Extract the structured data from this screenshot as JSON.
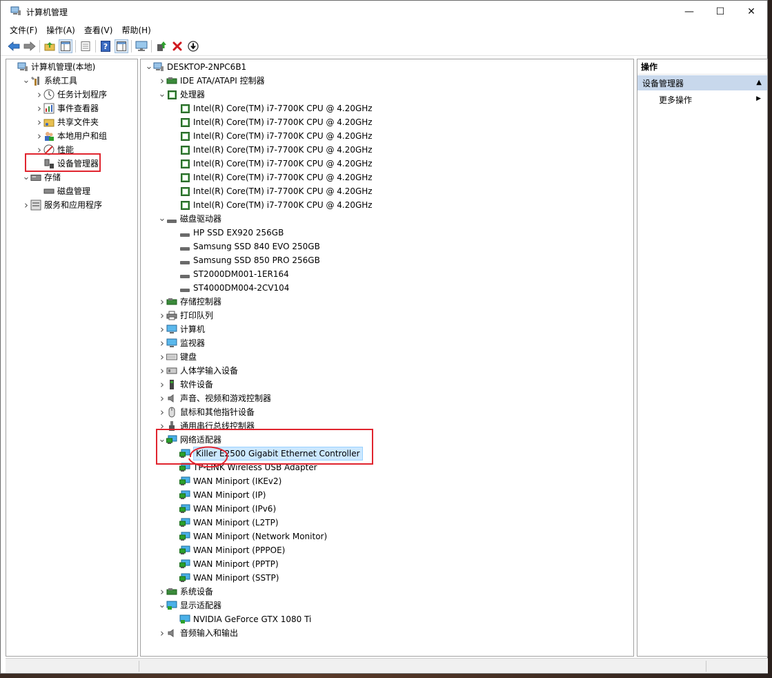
{
  "window": {
    "title": "计算机管理",
    "minimize": "—",
    "maximize": "☐",
    "close": "✕"
  },
  "menu": [
    "文件(F)",
    "操作(A)",
    "查看(V)",
    "帮助(H)"
  ],
  "left_tree": [
    {
      "label": "计算机管理(本地)",
      "level": 0,
      "expander": "",
      "icon": "computer-management-icon"
    },
    {
      "label": "系统工具",
      "level": 1,
      "expander": "open",
      "icon": "tools-icon"
    },
    {
      "label": "任务计划程序",
      "level": 2,
      "expander": "closed",
      "icon": "clock-icon"
    },
    {
      "label": "事件查看器",
      "level": 2,
      "expander": "closed",
      "icon": "event-viewer-icon"
    },
    {
      "label": "共享文件夹",
      "level": 2,
      "expander": "closed",
      "icon": "shared-folder-icon"
    },
    {
      "label": "本地用户和组",
      "level": 2,
      "expander": "closed",
      "icon": "users-icon"
    },
    {
      "label": "性能",
      "level": 2,
      "expander": "closed",
      "icon": "performance-icon"
    },
    {
      "label": "设备管理器",
      "level": 2,
      "expander": "",
      "icon": "device-manager-icon"
    },
    {
      "label": "存储",
      "level": 1,
      "expander": "open",
      "icon": "storage-icon"
    },
    {
      "label": "磁盘管理",
      "level": 2,
      "expander": "",
      "icon": "disk-management-icon"
    },
    {
      "label": "服务和应用程序",
      "level": 1,
      "expander": "closed",
      "icon": "services-icon"
    }
  ],
  "device_tree": [
    {
      "label": "DESKTOP-2NPC6B1",
      "level": 0,
      "expander": "open",
      "icon": "computer-icon"
    },
    {
      "label": "IDE ATA/ATAPI 控制器",
      "level": 1,
      "expander": "closed",
      "icon": "ide-controller-icon"
    },
    {
      "label": "处理器",
      "level": 1,
      "expander": "open",
      "icon": "processor-icon"
    },
    {
      "label": "Intel(R) Core(TM) i7-7700K CPU @ 4.20GHz",
      "level": 2,
      "expander": "",
      "icon": "processor-icon"
    },
    {
      "label": "Intel(R) Core(TM) i7-7700K CPU @ 4.20GHz",
      "level": 2,
      "expander": "",
      "icon": "processor-icon"
    },
    {
      "label": "Intel(R) Core(TM) i7-7700K CPU @ 4.20GHz",
      "level": 2,
      "expander": "",
      "icon": "processor-icon"
    },
    {
      "label": "Intel(R) Core(TM) i7-7700K CPU @ 4.20GHz",
      "level": 2,
      "expander": "",
      "icon": "processor-icon"
    },
    {
      "label": "Intel(R) Core(TM) i7-7700K CPU @ 4.20GHz",
      "level": 2,
      "expander": "",
      "icon": "processor-icon"
    },
    {
      "label": "Intel(R) Core(TM) i7-7700K CPU @ 4.20GHz",
      "level": 2,
      "expander": "",
      "icon": "processor-icon"
    },
    {
      "label": "Intel(R) Core(TM) i7-7700K CPU @ 4.20GHz",
      "level": 2,
      "expander": "",
      "icon": "processor-icon"
    },
    {
      "label": "Intel(R) Core(TM) i7-7700K CPU @ 4.20GHz",
      "level": 2,
      "expander": "",
      "icon": "processor-icon"
    },
    {
      "label": "磁盘驱动器",
      "level": 1,
      "expander": "open",
      "icon": "disk-icon"
    },
    {
      "label": "HP SSD EX920 256GB",
      "level": 2,
      "expander": "",
      "icon": "disk-icon"
    },
    {
      "label": "Samsung SSD 840 EVO 250GB",
      "level": 2,
      "expander": "",
      "icon": "disk-icon"
    },
    {
      "label": "Samsung SSD 850 PRO 256GB",
      "level": 2,
      "expander": "",
      "icon": "disk-icon"
    },
    {
      "label": "ST2000DM001-1ER164",
      "level": 2,
      "expander": "",
      "icon": "disk-icon"
    },
    {
      "label": "ST4000DM004-2CV104",
      "level": 2,
      "expander": "",
      "icon": "disk-icon"
    },
    {
      "label": "存储控制器",
      "level": 1,
      "expander": "closed",
      "icon": "storage-controller-icon"
    },
    {
      "label": "打印队列",
      "level": 1,
      "expander": "closed",
      "icon": "printer-icon"
    },
    {
      "label": "计算机",
      "level": 1,
      "expander": "closed",
      "icon": "monitor-icon"
    },
    {
      "label": "监视器",
      "level": 1,
      "expander": "closed",
      "icon": "monitor-icon"
    },
    {
      "label": "键盘",
      "level": 1,
      "expander": "closed",
      "icon": "keyboard-icon"
    },
    {
      "label": "人体学输入设备",
      "level": 1,
      "expander": "closed",
      "icon": "hid-icon"
    },
    {
      "label": "软件设备",
      "level": 1,
      "expander": "closed",
      "icon": "software-device-icon"
    },
    {
      "label": "声音、视频和游戏控制器",
      "level": 1,
      "expander": "closed",
      "icon": "speaker-icon"
    },
    {
      "label": "鼠标和其他指针设备",
      "level": 1,
      "expander": "closed",
      "icon": "mouse-icon"
    },
    {
      "label": "通用串行总线控制器",
      "level": 1,
      "expander": "closed",
      "icon": "usb-icon"
    },
    {
      "label": "网络适配器",
      "level": 1,
      "expander": "open",
      "icon": "network-adapter-icon"
    },
    {
      "label": "Killer E2500 Gigabit Ethernet Controller",
      "level": 2,
      "expander": "",
      "icon": "network-adapter-icon",
      "selected": true
    },
    {
      "label": "TP-LINK Wireless USB Adapter",
      "level": 2,
      "expander": "",
      "icon": "network-adapter-icon"
    },
    {
      "label": "WAN Miniport (IKEv2)",
      "level": 2,
      "expander": "",
      "icon": "network-adapter-icon"
    },
    {
      "label": "WAN Miniport (IP)",
      "level": 2,
      "expander": "",
      "icon": "network-adapter-icon"
    },
    {
      "label": "WAN Miniport (IPv6)",
      "level": 2,
      "expander": "",
      "icon": "network-adapter-icon"
    },
    {
      "label": "WAN Miniport (L2TP)",
      "level": 2,
      "expander": "",
      "icon": "network-adapter-icon"
    },
    {
      "label": "WAN Miniport (Network Monitor)",
      "level": 2,
      "expander": "",
      "icon": "network-adapter-icon"
    },
    {
      "label": "WAN Miniport (PPPOE)",
      "level": 2,
      "expander": "",
      "icon": "network-adapter-icon"
    },
    {
      "label": "WAN Miniport (PPTP)",
      "level": 2,
      "expander": "",
      "icon": "network-adapter-icon"
    },
    {
      "label": "WAN Miniport (SSTP)",
      "level": 2,
      "expander": "",
      "icon": "network-adapter-icon"
    },
    {
      "label": "系统设备",
      "level": 1,
      "expander": "closed",
      "icon": "system-device-icon"
    },
    {
      "label": "显示适配器",
      "level": 1,
      "expander": "open",
      "icon": "display-adapter-icon"
    },
    {
      "label": "NVIDIA GeForce GTX 1080 Ti",
      "level": 2,
      "expander": "",
      "icon": "display-adapter-icon"
    },
    {
      "label": "音频输入和输出",
      "level": 1,
      "expander": "closed",
      "icon": "speaker-icon"
    }
  ],
  "actions": {
    "header": "操作",
    "section": "设备管理器",
    "more": "更多操作"
  },
  "colors": {
    "highlight_red": "#e0242e",
    "selection_bg": "#cce8ff",
    "action_section_bg": "#c8d8ec"
  }
}
